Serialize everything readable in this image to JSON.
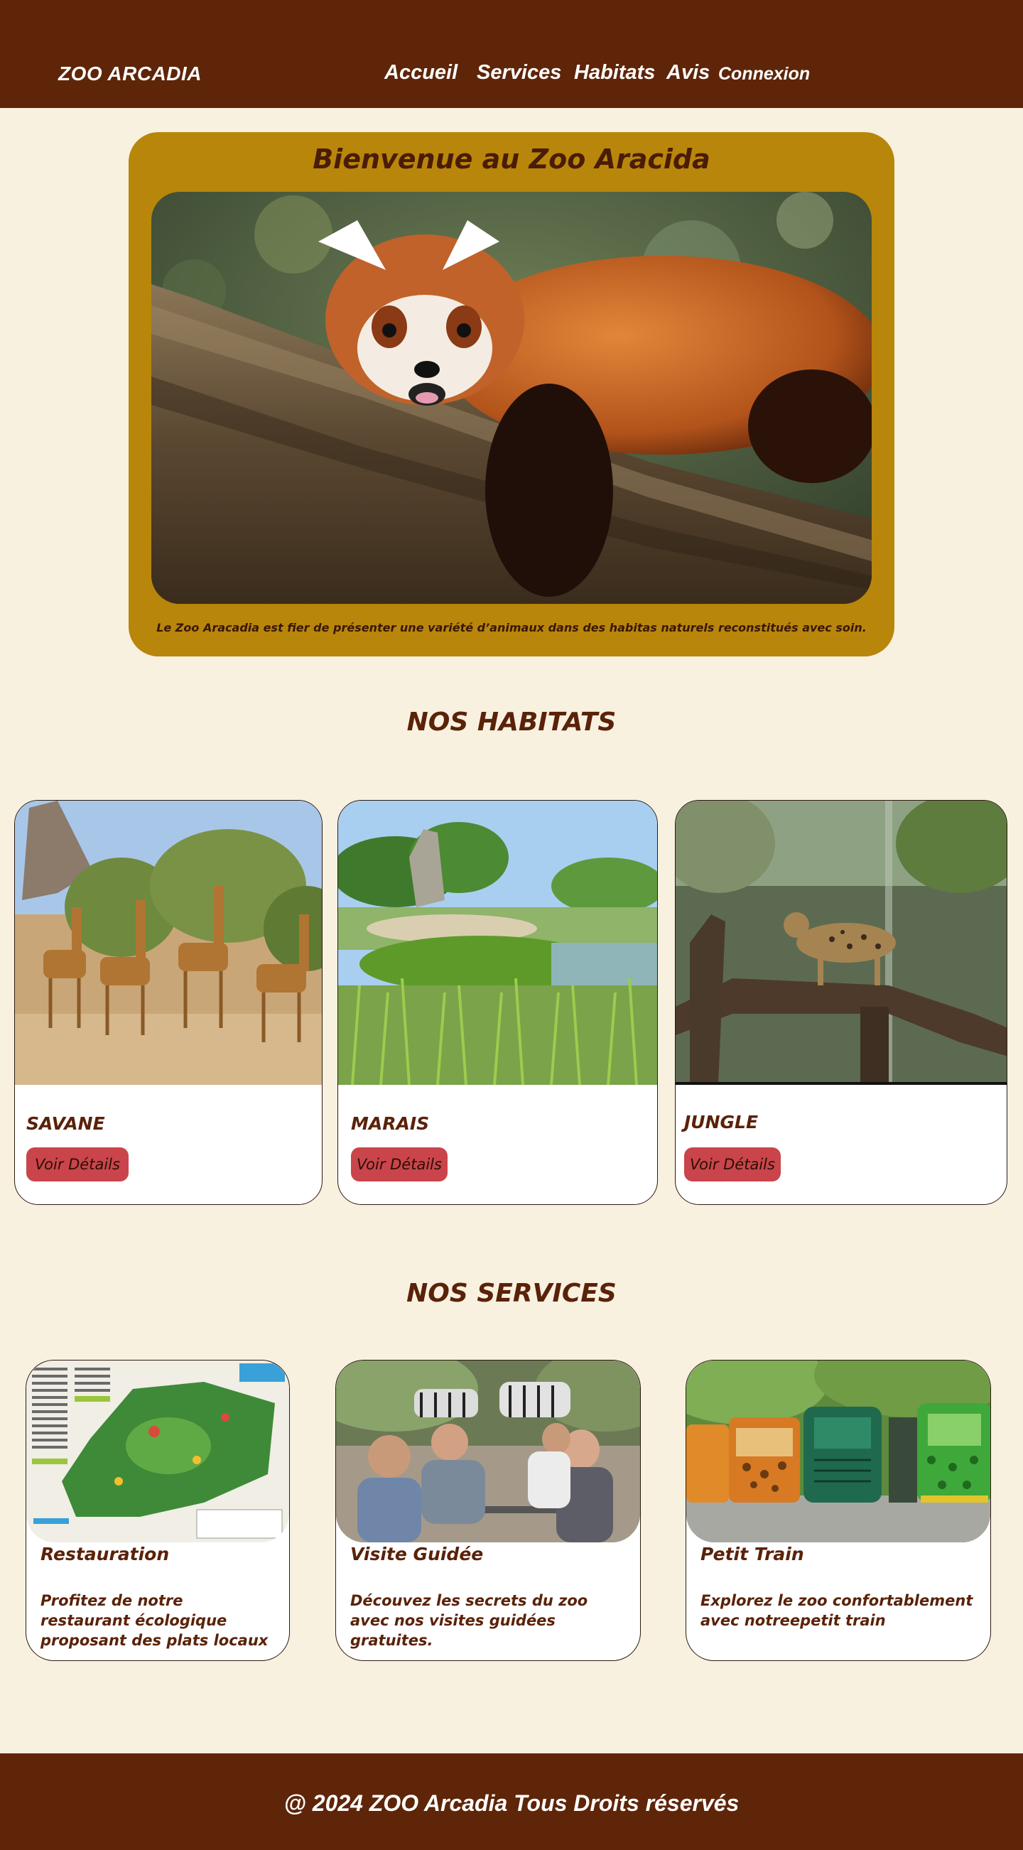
{
  "header": {
    "logo": "ZOO ARCADIA",
    "nav": [
      {
        "label": "Accueil"
      },
      {
        "label": "Services"
      },
      {
        "label": "Habitats"
      },
      {
        "label": "Avis"
      },
      {
        "label": "Connexion"
      }
    ]
  },
  "hero": {
    "title": "Bienvenue au Zoo Aracida",
    "image_alt": "red-panda-photo",
    "caption": "Le Zoo Aracadia est fier de présenter une variété d’animaux dans des habitas naturels reconstitués avec soin."
  },
  "habitats": {
    "title": "NOS HABITATS",
    "cards": [
      {
        "name": "SAVANE",
        "button": "Voir Détails",
        "image": "giraffes-photo"
      },
      {
        "name": "MARAIS",
        "button": "Voir Détails",
        "image": "marsh-photo"
      },
      {
        "name": "JUNGLE",
        "button": "Voir Détails",
        "image": "leopard-photo"
      }
    ]
  },
  "services": {
    "title": "NOS SERVICES",
    "cards": [
      {
        "title": "Restauration",
        "description": "Profitez de notre restaurant écologique proposant des plats locaux",
        "image": "zoo-map-photo"
      },
      {
        "title": "Visite Guidée",
        "description": "Découvez les secrets du zoo avec nos visites guidées gratuites.",
        "image": "zebras-people-photo"
      },
      {
        "title": "Petit Train",
        "description": "Explorez le zoo confortablement avec notreepetit train",
        "image": "trains-photo"
      }
    ]
  },
  "footer": {
    "text": "@ 2024 ZOO Arcadia Tous Droits réservés"
  },
  "colors": {
    "header_bg": "#5e2509",
    "page_bg": "#f8f1e0",
    "hero_bg": "#b8860b",
    "button_bg": "#c9454b",
    "text_brown": "#5a2209"
  }
}
